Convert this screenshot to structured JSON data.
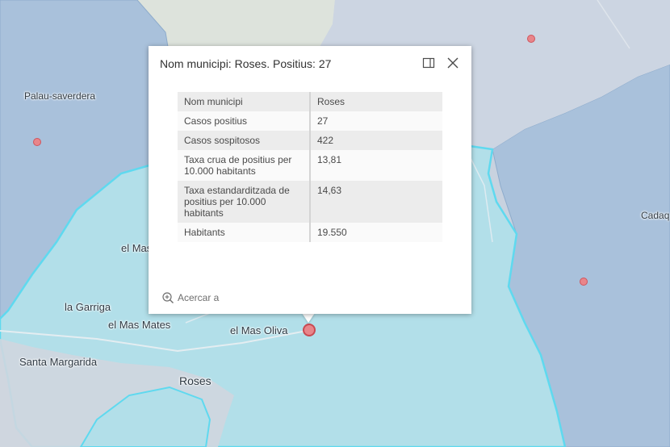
{
  "map": {
    "labels": {
      "palau_saverdera": "Palau-saverdera",
      "el_mas": "el Mas",
      "la_garriga": "la Garriga",
      "el_mas_mates": "el Mas Mates",
      "el_mas_oliva": "el Mas Oliva",
      "santa_margarida": "Santa Margarida",
      "roses": "Roses",
      "cadaq": "Cadaq"
    },
    "colors": {
      "region_blue": "#aec4dc",
      "selected_region": "#b3e0ea",
      "selected_outline": "#5fd9ef",
      "land": "#d5dbe4",
      "marker": "#e8858a"
    }
  },
  "popup": {
    "title": "Nom municipi: Roses. Positius: 27",
    "dock_icon": "dock-icon",
    "close_icon": "close-icon",
    "rows": [
      {
        "key": "Nom municipi",
        "value": "Roses"
      },
      {
        "key": "Casos positius",
        "value": "27"
      },
      {
        "key": "Casos sospitosos",
        "value": "422"
      },
      {
        "key": "Taxa crua de positius per 10.000 habitants",
        "value": "13,81"
      },
      {
        "key": "Taxa estandarditzada de positius per 10.000 habitants",
        "value": "14,63"
      },
      {
        "key": "Habitants",
        "value": "19.550"
      }
    ],
    "zoom_label": "Acercar a",
    "zoom_icon": "zoom-in-icon"
  }
}
